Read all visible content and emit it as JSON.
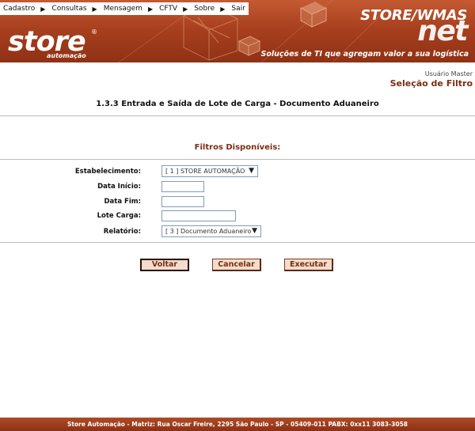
{
  "menu": {
    "items": [
      {
        "label": "Cadastro"
      },
      {
        "label": "Consultas"
      },
      {
        "label": "Mensagem"
      },
      {
        "label": "CFTV"
      },
      {
        "label": "Sobre"
      },
      {
        "label": "Sair"
      }
    ]
  },
  "header": {
    "logo_text": "store",
    "logo_registered": "®",
    "logo_subtitle": "automação",
    "brand_top": "STORE/WMAS",
    "brand_net": "net",
    "tagline": "Soluções de TI que agregam valor a sua logística",
    "background_color": "#a8401e"
  },
  "user": {
    "name": "Usuário Master",
    "page_title": "Seleção de Filtro"
  },
  "main": {
    "title": "1.3.3 Entrada e Saída de Lote de Carga - Documento Aduaneiro",
    "filters_title": "Filtros Disponíveis:"
  },
  "form": {
    "estabelecimento": {
      "label": "Estabelecimento:",
      "value": "[ 1 ] STORE AUTOMAÇÃO"
    },
    "data_inicio": {
      "label": "Data Início:",
      "value": ""
    },
    "data_fim": {
      "label": "Data Fim:",
      "value": ""
    },
    "lote_carga": {
      "label": "Lote Carga:",
      "value": ""
    },
    "relatorio": {
      "label": "Relatório:",
      "value": "[ 3 ] Documento Aduaneiro"
    }
  },
  "buttons": {
    "voltar": "Voltar",
    "cancelar": "Cancelar",
    "executar": "Executar"
  },
  "footer": {
    "text": "Store Automação - Matriz: Rua Oscar Freire, 2295 São Paulo - SP - 05409-011 PABX: 0xx11 3083-3058"
  },
  "colors": {
    "accent": "#7a2e12",
    "button_bg": "#f3dccb",
    "footer_bg": "#9a3a1c"
  }
}
